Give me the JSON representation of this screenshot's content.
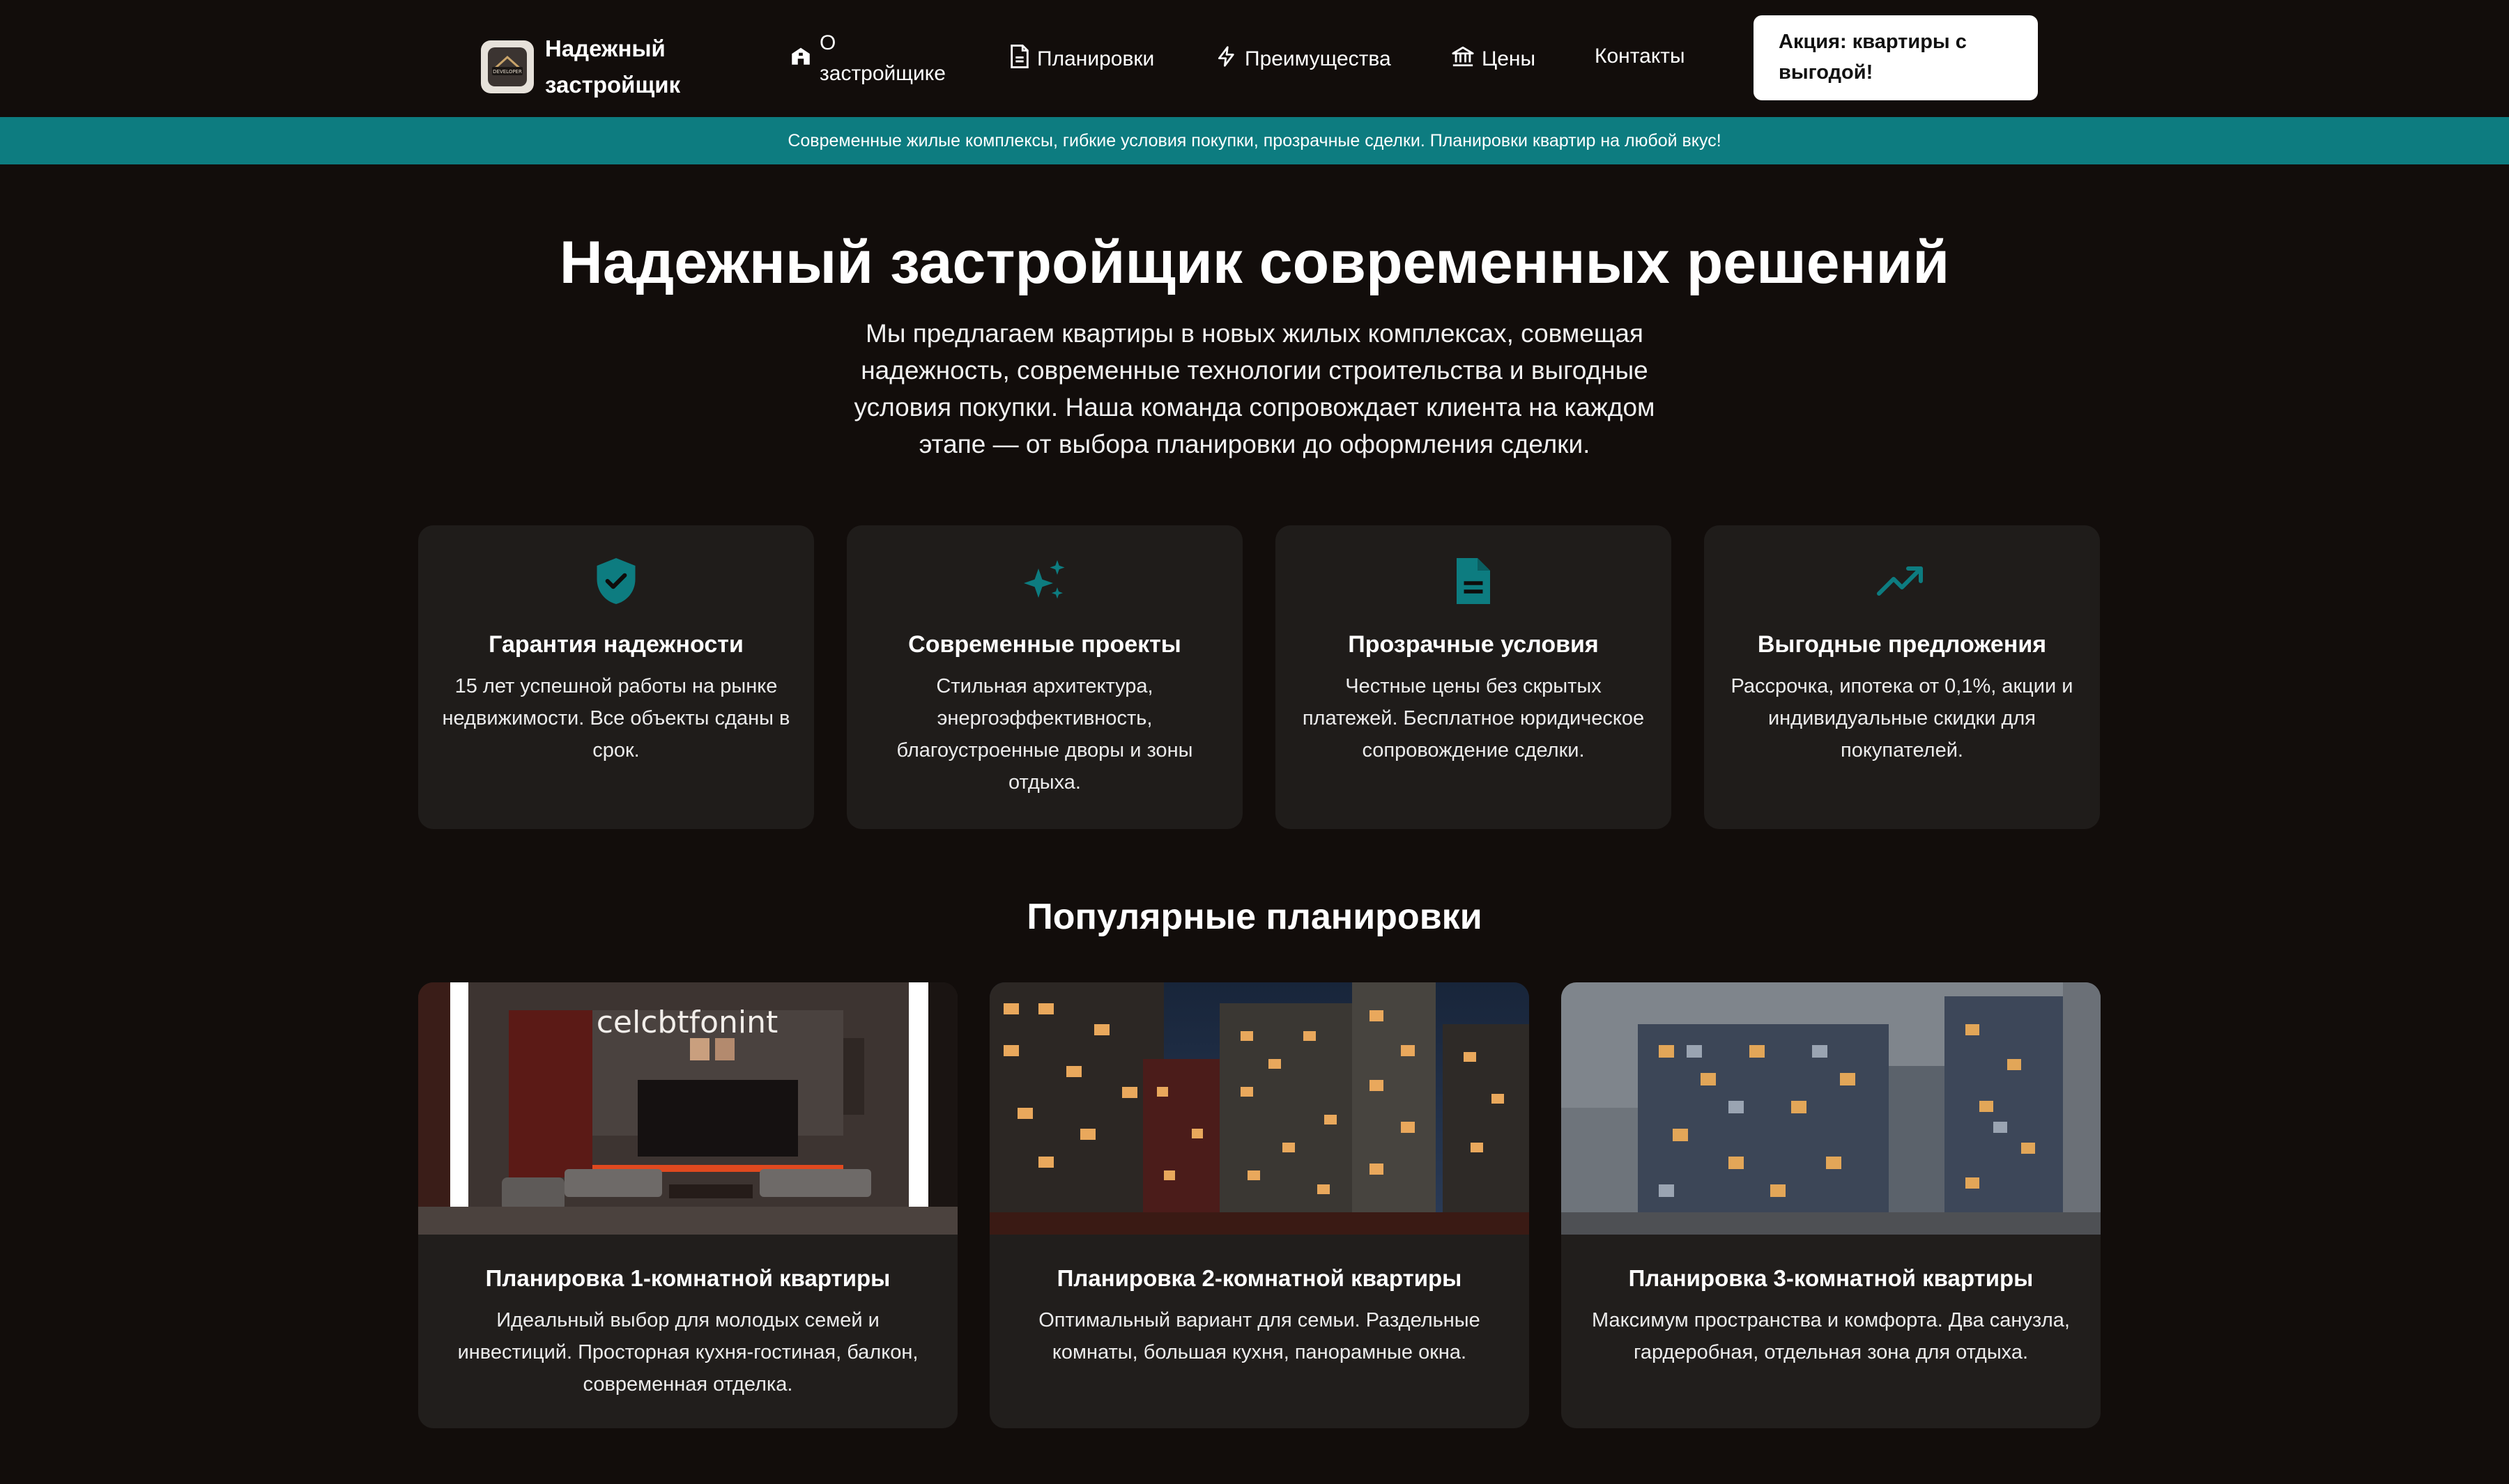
{
  "header": {
    "logo_text": "Надежный застройщик",
    "logo_badge": "DEVELOPER",
    "nav": [
      {
        "label": "О застройщике",
        "icon": "building-icon"
      },
      {
        "label": "Планировки",
        "icon": "document-icon"
      },
      {
        "label": "Преимущества",
        "icon": "lightning-icon"
      },
      {
        "label": "Цены",
        "icon": "bank-icon"
      },
      {
        "label": "Контакты",
        "icon": ""
      }
    ],
    "promo_button": "Акция: квартиры с выгодой!"
  },
  "banner": {
    "text": "Современные жилые комплексы, гибкие условия покупки, прозрачные сделки. Планировки квартир на любой вкус!"
  },
  "hero": {
    "title": "Надежный застройщик современных решений",
    "text": "Мы предлагаем квартиры в новых жилых комплексах, совмещая надежность, современные технологии строительства и выгодные условия покупки. Наша команда сопровождает клиента на каждом этапе — от выбора планировки до оформления сделки."
  },
  "features": [
    {
      "icon": "shield-check-icon",
      "title": "Гарантия надежности",
      "text": "15 лет успешной работы на рынке недвижимости. Все объекты сданы в срок."
    },
    {
      "icon": "sparkles-icon",
      "title": "Современные проекты",
      "text": "Стильная архитектура, энергоэффективность, благоустроенные дворы и зоны отдыха."
    },
    {
      "icon": "document-icon",
      "title": "Прозрачные условия",
      "text": "Честные цены без скрытых платежей. Бесплатное юридическое сопровождение сделки."
    },
    {
      "icon": "trending-up-icon",
      "title": "Выгодные предложения",
      "text": "Рассрочка, ипотека от 0,1%, акции и индивидуальные скидки для покупателей."
    }
  ],
  "plans_section": {
    "title": "Популярные планировки",
    "items": [
      {
        "image_caption": "celcbtfonint",
        "title": "Планировка 1-комнатной квартиры",
        "text": "Идеальный выбор для молодых семей и инвестиций. Просторная кухня-гостиная, балкон, современная отделка."
      },
      {
        "image_caption": "",
        "title": "Планировка 2-комнатной квартиры",
        "text": "Оптимальный вариант для семьи. Раздельные комнаты, большая кухня, панорамные окна."
      },
      {
        "image_caption": "",
        "title": "Планировка 3-комнатной квартиры",
        "text": "Максимум пространства и комфорта. Два санузла, гардеробная, отдельная зона для отдыха."
      }
    ]
  },
  "colors": {
    "background": "#120d0b",
    "accent": "#0d7c80",
    "card": "#1f1c1a"
  }
}
